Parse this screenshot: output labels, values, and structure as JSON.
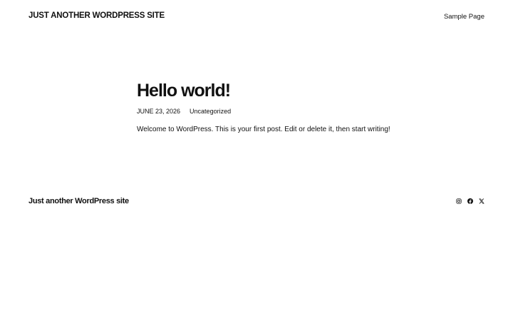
{
  "header": {
    "site_title": "JUST ANOTHER WORDPRESS SITE",
    "nav": [
      {
        "label": "Sample Page"
      }
    ]
  },
  "post": {
    "title": "Hello world!",
    "date": "JUNE 23, 2026",
    "category": "Uncategorized",
    "content": "Welcome to WordPress. This is your first post. Edit or delete it, then start writing!"
  },
  "footer": {
    "site_title": "Just another WordPress site",
    "social_icons": [
      "instagram-icon",
      "facebook-icon",
      "x-icon"
    ]
  },
  "colors": {
    "background": "#ffffff",
    "text": "#111111"
  }
}
